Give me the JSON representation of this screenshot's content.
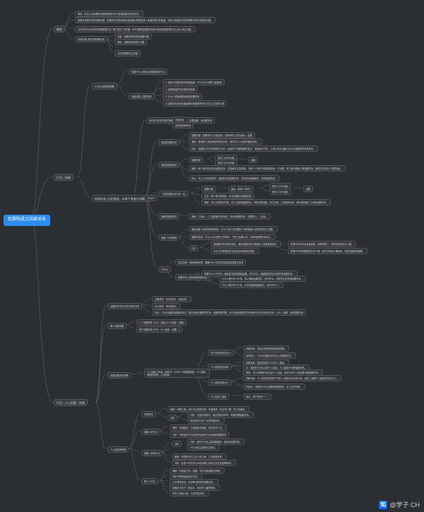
{
  "title": "犯罪构成之因果关系",
  "watermark": "@学子 CH",
  "zhihu": "知",
  "l1": {
    "a": "概述",
    "b": "行为→结果",
    "c": "行为→介入因素→结果"
  },
  "a": {
    "n1": "概念：刑法上的因果关系是指危害行为与危害结果之间的关系。",
    "n2": "因果关系解决的是定罪问题，因果的实质是看能否将结果主要算是某人危害犯罪中的危害，而非已经确定构成犯罪再去看有关害的问题。",
    "n3": "对于刑事行为责任的问题需要注意 \"唐门陨石\" 的问题，即不需要查因果关系的半遂危或者犯罪行为认应以成立问题。",
    "n4a": "前提问题 (是否有因果关系)",
    "n4b": "对象：结果加重构成的因果问题",
    "n4c": "审核：结果加重的成立问题",
    "n4d": "过失犯罪的成立问题"
  },
  "b": {
    "hd": "行为与结果判断",
    "hd_sub": "危害行为 (具有法益侵害性的行为)",
    "hd_sub2": "危害结果 (主要问题)",
    "s1": "1. 最狭义处理定是外客观结果，不以行为人预料 (查客观)",
    "s2": "2. 最狭是强护刑法规范的结果",
    "s3": "3. 行为人有客观规则造成因果关系",
    "s4": "4. 因果关系及有危害结果到现造成再内行为应之实克的认事",
    "cond_hd": "构造标准 (无此角度，以两个角度分别确认)",
    "cond_sub": "条件说 (条件关系的判断)：行为是结果→犯罪结果→有因果关系",
    "cond_sub2": "归因设定",
    "cond_sub2a": "合法则的条件说",
    "cond_g1": "相因的因果关系",
    "cond_g1_1": "因果历程：因果条件 (分别适用)→因事条件 (合并适用)→结果",
    "cond_g1_2": "案例：剧深死亡原因有是甲药的关系，案件中乙以为是甲害的关系。",
    "cond_g1_3": "特点：如果有几件分别实施行为时，就造成了犯罪结果的发生，则避免对于甲、乙的行为应当都认定为与结果有所有果关系。",
    "cond_g2": "叠加的因果关系",
    "cond_g2_1a": "因果历程",
    "cond_g2_1b": "条件1 (50%作用)",
    "cond_g2_1c": "条件2 (50%作用)",
    "cond_g2_1d": "结果",
    "cond_g2_2": "案例：两个案件在但没有因果关系，正因案件主观问题，它两个个条件不是单独导致一个结果，甲乙都与被害人有因果关系，都成立故意杀人犯罪没建。",
    "cond_g2_3": "特点：甲乙以完完成调节，相因存在的因果关系，共同成为结果条件，构成因果关系。",
    "cond_g3": "二重的因果关系 (择一论)",
    "cond_g3_1a": "因果历程",
    "cond_g3_1b": "因素→条件1+条件2",
    "cond_g3_1c": "条件1 (100%起)",
    "cond_g3_1d": "条件2 (100%起)",
    "cond_g3_1e": "结果",
    "cond_g3_2": "注意：两个条件单独定，均与结果存在因果关系",
    "cond_g3_3": "案例：甲乙共谋同时开枪，甲乙合雷有因果关系，均是犯罪没建。甲乙共谋，乙单改有关系，都与结刑确亡之间有因果关系。",
    "cond_g4": "阻断的因果关系",
    "cond_g4_1": "案例：乙取水、乙上路的都不带水壶，甲玩有因果关系，犯罪死人、乙请走。",
    "cond_g5": "被害人对的修段",
    "cond_g5_1a": "假没被害人身段特殊的构成，行为人的行为的直接个导致被害人的构成的死亡结果。",
    "cond_g5_1b": "因果关系是。行为人行为是死亡的条件，于死亡结果以有，不影响因果关系成立。",
    "cond_g5_1c": "讨论",
    "cond_g5_1c1": "有因果关系并影响定性。确定因果关系只是确定了此审客观是件。",
    "cond_g5_1c2": "行为人的是场状态决定是否承担故意或罪。",
    "cond_g5_1c3": "犯罪中甲本向未且使特殊，特殊导致了。明甲构成故意杀人罪。",
    "cond_g5_1c4": "犯罪中甲不和遭犯故意杀人罪，因为不构成以果和死，犯故意致层构害罪。",
    "cond_nk": "不作为",
    "cond_nk_1": "发生的病：预设两种情境、疑解行为人侵犯合则知该结果发生而非",
    "cond_nk_2": "如果行为人行作为，确定是否能够避免结果。本行作为，结果若的成功与自然有因果关系。",
    "cond_nk_3": "因果关系 (目标被案客观判定)",
    "cond_nk_3a": "行为人履行作义义务，的以避免结果发生，其不作为，这是发生的关索因果关系。",
    "cond_nk_3b": "行为人履行作义义务，仍无没避免结果发生，其不作为人。"
  },
  "c": {
    "hd1": "必要条件关系与充分条件关系",
    "hd1_1": "必要条件：无A则无B，A即必然。",
    "hd1_2": "充分条件：有A则有B。",
    "hd1_3": "特点：行为与结果的因果关系中，如存没有必要条件关系，结果就算归属。对于没有必要条件关系而不存在充分条件关系：行为→结果→没有因果关系",
    "hd2": "两个因果进程",
    "hd2_1": "三个因果条件 (行为→因素) (介入因素→结果)",
    "hd2_2": "两个因果关系 (行为→介入因素→结果→)",
    "jud": "危险因果关系判断",
    "jud_sub": "介入因素三标准（前情节：行为介入的结果强因→介入因素制造的危险→1.比较量）",
    "jud_1": "先行为的危险性大小",
    "jud_1a": "判断标准：是否达到加重的能导致范围。",
    "jud_1b": "危险性大：行为与结果存在刑法上的因果关系。",
    "jud_2": "介入因素是否具体",
    "jud_2a": "判断标准：是否狭性质义义在介入因素。",
    "jud_2b": "小：相是先行为引出的介入因素，介入因素不中断因果关系。",
    "jud_2c": "异常：先行为想等不会引出介入因素，除非公序介入因素等中断因果关系。",
    "jud_3": "介入因素作用大小",
    "jud_3a": "判断标准：介入因素是否发挥了该介入因素支必决定作用，还是二者都介入因素的本页大小。",
    "jud_3b": "作用大：中断先行为与结果的因果关系，反之没有中断。",
    "jud_4": "介入因素三因素",
    "jud_4a": "结论：把介前归于！！",
    "iv": "介入因素的种类",
    "iv_1": "自然条件",
    "iv_1a": "案例：甲救乙逃，构乙乃正受到天系。甲害被杀，构意杀人罪。甲乙老害死。",
    "iv_1b": "分析：这里自然条件，构意然度但闪甲，构造犯罪因果关系。",
    "iv_1b2": "构意杀的行为广大的构果关系。",
    "iv_2": "被害人的行为",
    "iv_2a": "案例：甲追逐情，乙害逃至佘路被，构也告杀人意。",
    "iv_2b": "分析：甲的追杀行为会验夺后做法行为自制构因果关系",
    "iv_3": "被害人自残行为",
    "iv_3a": "分析：被付行为没主告减被害的，因此有因果关系。",
    "iv_3b": "介行为是主害知情生第过。",
    "iv_3c": "案例：甲结等对打乙无人的乙每，乙半跳被自杀。",
    "iv_3d": "分析：这里人的自杀行为情由等乙知情过定危关因果系的。",
    "iv_4": "第三人行为",
    "iv_4a": "案例：内医给乙构，因果，甲生辛医因果关系等。",
    "iv_4b": "甲生辛构是定医没过关系。",
    "iv_4c": "乙半等杀这言，对甲等法情称夫因果关系。",
    "iv_4d": "构害定半定于',\"因素夫，构意杀人害处配定。",
    "iv_4e": "甲半乙命绝人因，乃意甲没关系。"
  }
}
